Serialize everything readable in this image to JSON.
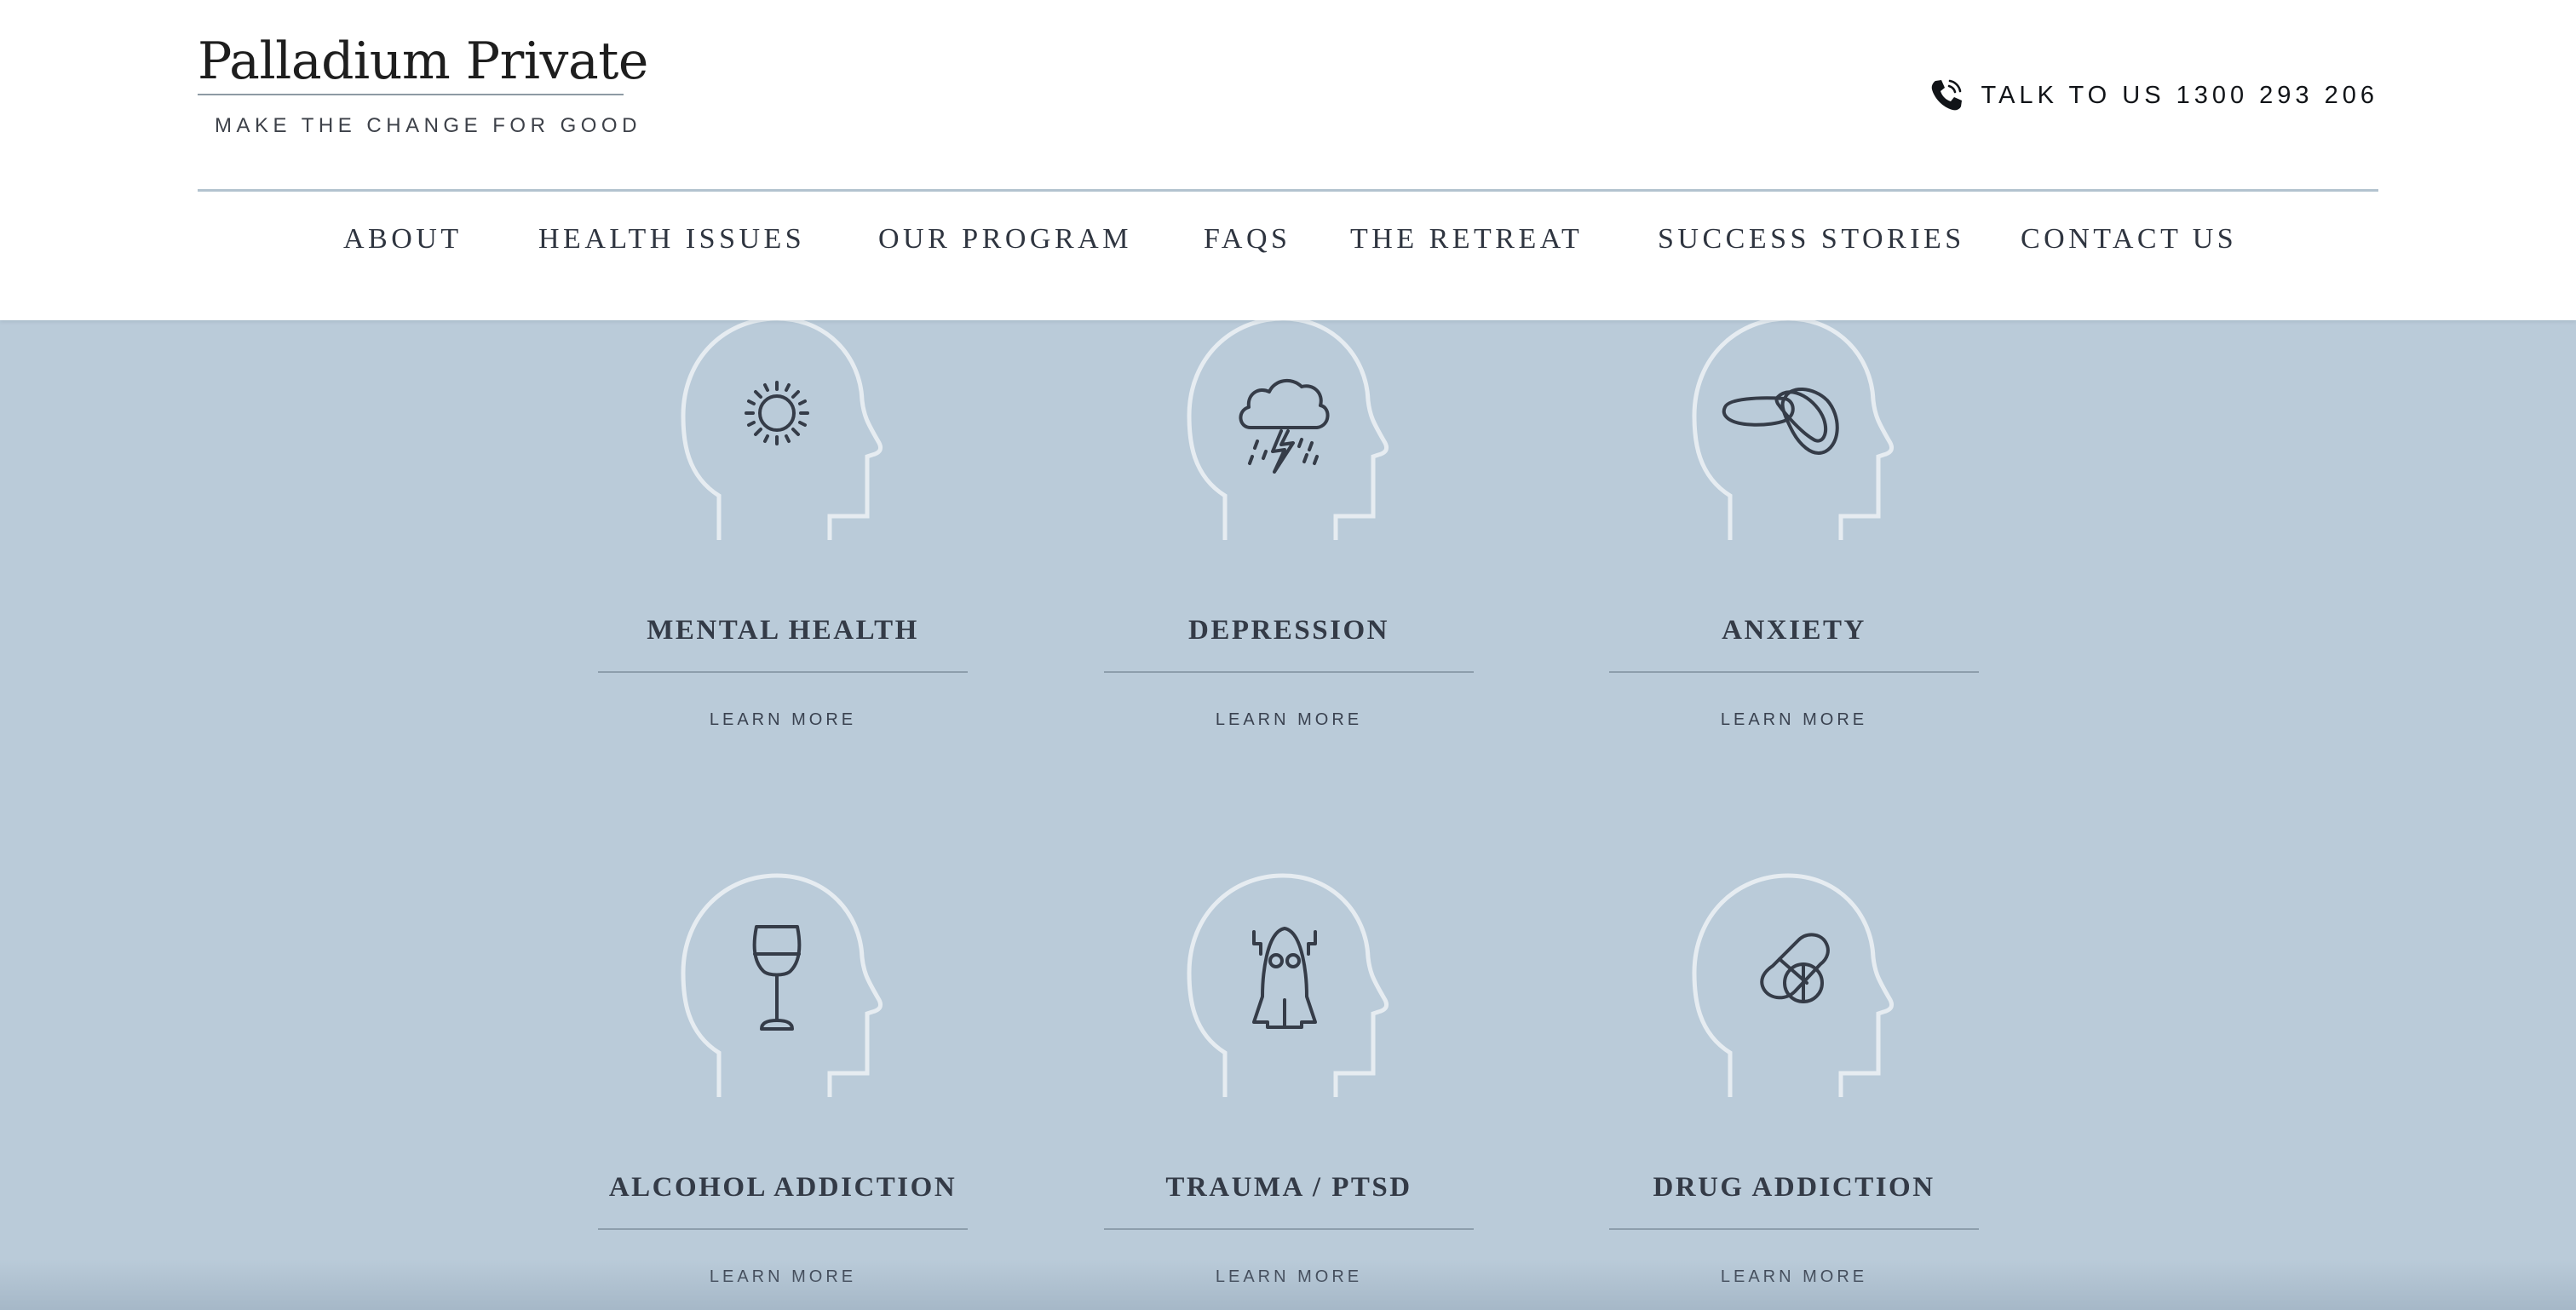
{
  "brand": {
    "name": "Palladium Private",
    "tagline": "MAKE THE CHANGE FOR GOOD"
  },
  "contact": {
    "phone_label": "TALK TO US 1300 293 206",
    "icon": "phone-icon"
  },
  "nav": {
    "items": [
      {
        "label": "ABOUT"
      },
      {
        "label": "HEALTH ISSUES"
      },
      {
        "label": "OUR PROGRAM"
      },
      {
        "label": "FAQS"
      },
      {
        "label": "THE RETREAT"
      },
      {
        "label": "SUCCESS STORIES"
      },
      {
        "label": "CONTACT US"
      }
    ]
  },
  "services": {
    "cards": [
      {
        "title": "MENTAL HEALTH",
        "link": "LEARN MORE",
        "icon": "sun-icon"
      },
      {
        "title": "DEPRESSION",
        "link": "LEARN MORE",
        "icon": "storm-cloud-icon"
      },
      {
        "title": "ANXIETY",
        "link": "LEARN MORE",
        "icon": "tangled-thoughts-icon"
      },
      {
        "title": "ALCOHOL ADDICTION",
        "link": "LEARN MORE",
        "icon": "wine-glass-icon"
      },
      {
        "title": "TRAUMA / PTSD",
        "link": "LEARN MORE",
        "icon": "ghost-icon"
      },
      {
        "title": "DRUG ADDICTION",
        "link": "LEARN MORE",
        "icon": "pills-icon"
      }
    ]
  },
  "colors": {
    "background": "#bacbd9",
    "header": "#ffffff",
    "text_dark": "#343b47",
    "head_outline": "#e6ecf1"
  }
}
